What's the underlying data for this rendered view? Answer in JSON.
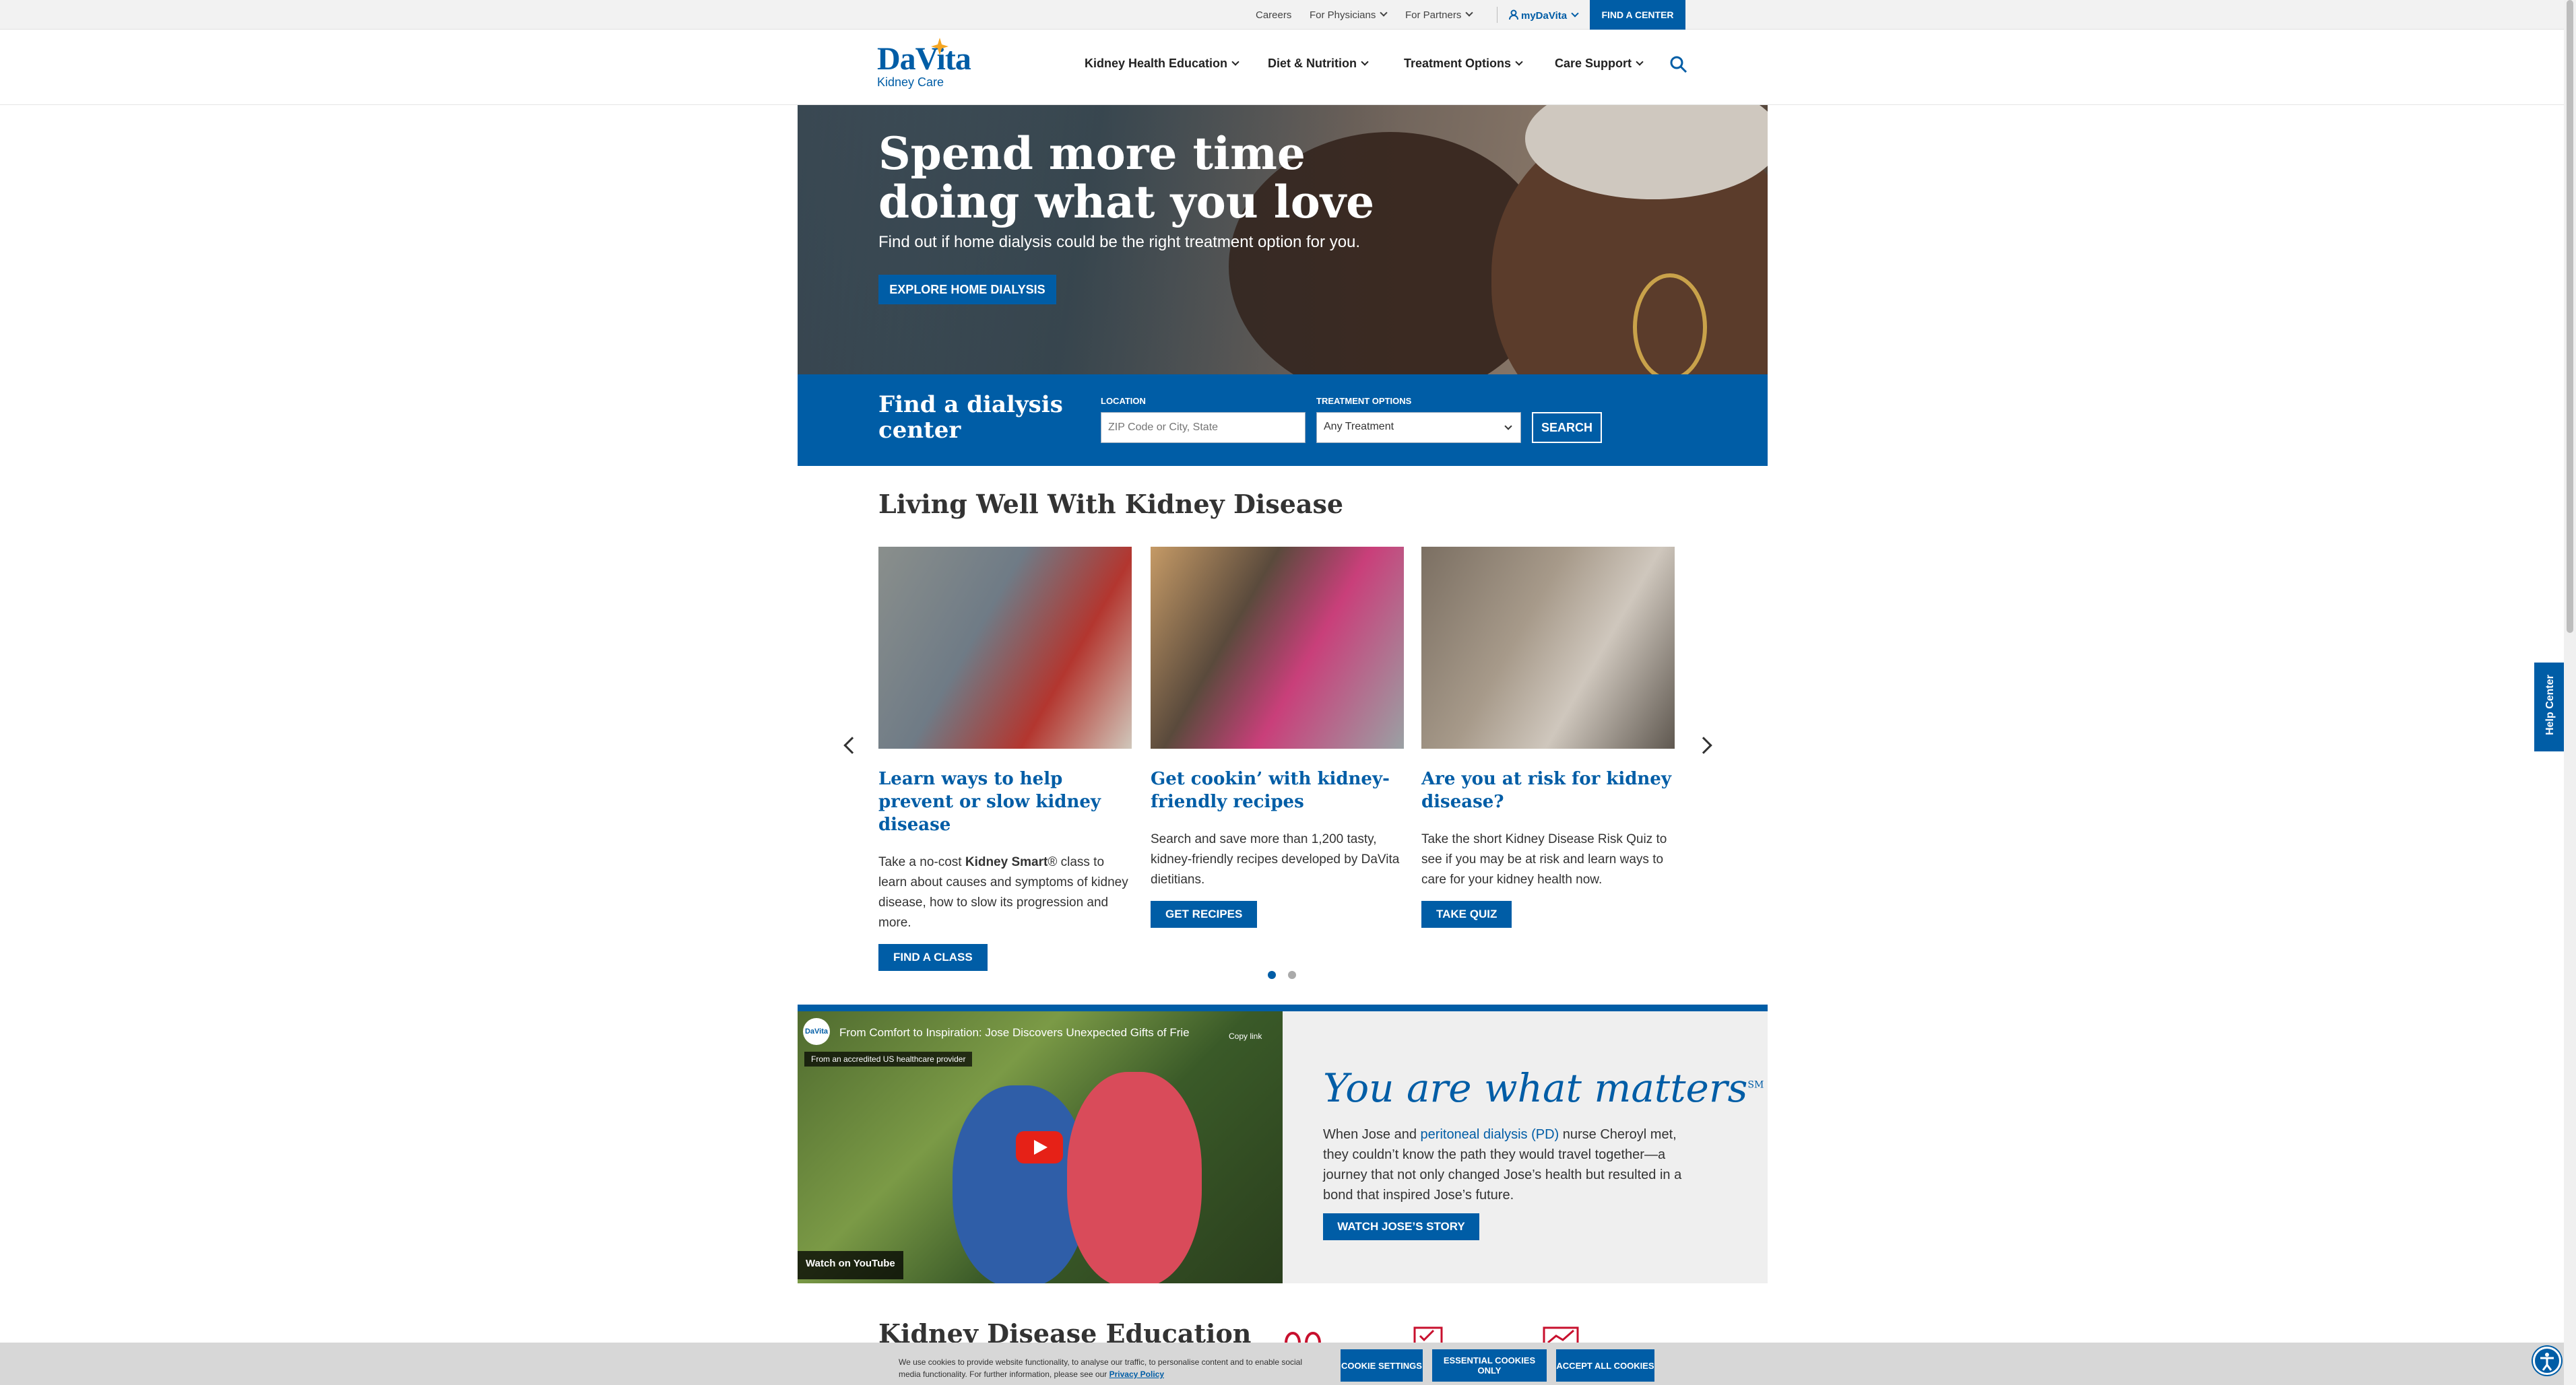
{
  "topbar": {
    "careers": "Careers",
    "physicians": "For Physicians",
    "partners": "For Partners",
    "mydavita": "myDaVita",
    "find_center": "FIND A CENTER"
  },
  "header": {
    "logo_wordmark": "DaVita",
    "logo_sub": "Kidney Care",
    "nav": [
      "Kidney Health Education",
      "Diet & Nutrition",
      "Treatment Options",
      "Care Support"
    ]
  },
  "hero": {
    "title": "Spend more time doing what you love",
    "subtitle": "Find out if home dialysis could be the right treatment option for you.",
    "cta": "EXPLORE HOME DIALYSIS"
  },
  "find": {
    "title": "Find a dialysis center",
    "location_label": "LOCATION",
    "location_placeholder": "ZIP Code or City, State",
    "treatment_label": "TREATMENT OPTIONS",
    "treatment_value": "Any Treatment",
    "search": "SEARCH"
  },
  "living": {
    "title": "Living Well With Kidney Disease",
    "cards": [
      {
        "title": "Learn ways to help prevent or slow kidney disease",
        "text_a": "Take a no-cost ",
        "text_b": "Kidney Smart",
        "text_c": "® class to learn about causes and symptoms of kidney disease, how to slow its progression and more.",
        "button": "FIND A CLASS"
      },
      {
        "title": "Get cookin’ with kidney-friendly recipes",
        "text": "Search and save more than 1,200 tasty, kidney-friendly recipes developed by DaVita dietitians.",
        "button": "GET RECIPES"
      },
      {
        "title": "Are you at risk for kidney disease?",
        "text": "Take the short Kidney Disease Risk Quiz to see if you may be at risk and learn ways to care for your kidney health now.",
        "button": "TAKE QUIZ"
      }
    ]
  },
  "video": {
    "title": "From Comfort to Inspiration: Jose Discovers Unexpected Gifts of Frie",
    "provider": "From an accredited US healthcare provider",
    "copy": "Copy link",
    "watch": "Watch on",
    "yt": "YouTube",
    "heading": "You are what matters",
    "sm": "SM",
    "text_a": "When Jose and ",
    "link": "peritoneal dialysis (PD)",
    "text_b": " nurse Cheroyl met, they couldn’t know the path they would travel together—a journey that not only changed Jose’s health but resulted in a bond that inspired Jose’s future.",
    "cta": "WATCH JOSE’S STORY"
  },
  "education": {
    "title": "Kidney Disease Education"
  },
  "help": "Help Center",
  "cookie": {
    "text": "We use cookies to provide website functionality, to analyse our traffic, to personalise content and to enable social media functionality. For further information, please see our ",
    "policy": "Privacy Policy",
    "settings": "COOKIE SETTINGS",
    "essential": "ESSENTIAL COOKIES ONLY",
    "accept": "ACCEPT ALL COOKIES"
  },
  "colors": {
    "brand": "#005da6",
    "accent_orange": "#f5a623"
  },
  "icons": [
    "search-icon",
    "user-icon",
    "chevron-down-icon",
    "arrow-left-icon",
    "arrow-right-icon",
    "youtube-play-icon",
    "accessibility-icon"
  ]
}
